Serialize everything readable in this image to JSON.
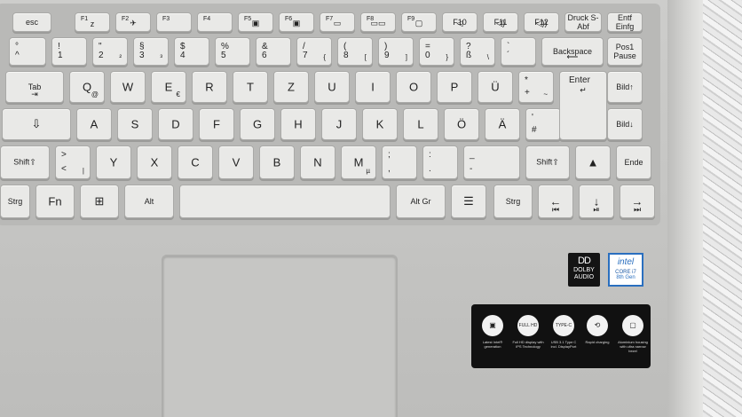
{
  "fn_row": [
    {
      "label": "esc"
    },
    {
      "label": "F1",
      "icon": "z"
    },
    {
      "label": "F2",
      "icon": "✈"
    },
    {
      "label": "F3"
    },
    {
      "label": "F4"
    },
    {
      "label": "F5",
      "icon": "▣"
    },
    {
      "label": "F6",
      "icon": "▣"
    },
    {
      "label": "F7",
      "icon": "▭"
    },
    {
      "label": "F8",
      "icon": "▭▭"
    },
    {
      "label": "F9",
      "icon": "▢"
    },
    {
      "label": "F10",
      "icon": "◁"
    },
    {
      "label": "F11",
      "icon": "◁)"
    },
    {
      "label": "F12",
      "icon": "◁))"
    },
    {
      "label": "Druck S-Abf"
    },
    {
      "label": "Entf Einfg"
    }
  ],
  "number_row": [
    {
      "top": "°",
      "bot": "^"
    },
    {
      "top": "!",
      "bot": "1"
    },
    {
      "top": "\"",
      "bot": "2",
      "sub": "²"
    },
    {
      "top": "§",
      "bot": "3",
      "sub": "³"
    },
    {
      "top": "$",
      "bot": "4"
    },
    {
      "top": "%",
      "bot": "5"
    },
    {
      "top": "&",
      "bot": "6"
    },
    {
      "top": "/",
      "bot": "7",
      "sub": "{"
    },
    {
      "top": "(",
      "bot": "8",
      "sub": "["
    },
    {
      "top": ")",
      "bot": "9",
      "sub": "]"
    },
    {
      "top": "=",
      "bot": "0",
      "sub": "}"
    },
    {
      "top": "?",
      "bot": "ß",
      "sub": "\\"
    },
    {
      "top": "`",
      "bot": "´"
    },
    {
      "label": "Backspace",
      "icon": "⟵"
    },
    {
      "label": "Pos1 Pause"
    }
  ],
  "qwertz_row": [
    {
      "label": "Tab",
      "icon": "⇥"
    },
    {
      "label": "Q",
      "sub": "@"
    },
    {
      "label": "W"
    },
    {
      "label": "E",
      "sub": "€"
    },
    {
      "label": "R"
    },
    {
      "label": "T"
    },
    {
      "label": "Z"
    },
    {
      "label": "U"
    },
    {
      "label": "I"
    },
    {
      "label": "O"
    },
    {
      "label": "P"
    },
    {
      "label": "Ü"
    },
    {
      "top": "*",
      "bot": "+",
      "sub": "~"
    },
    {
      "label": "Enter",
      "icon": "↵"
    },
    {
      "label": "Bild↑"
    }
  ],
  "home_row": [
    {
      "label": "⇩"
    },
    {
      "label": "A"
    },
    {
      "label": "S"
    },
    {
      "label": "D"
    },
    {
      "label": "F"
    },
    {
      "label": "G"
    },
    {
      "label": "H"
    },
    {
      "label": "J"
    },
    {
      "label": "K"
    },
    {
      "label": "L"
    },
    {
      "label": "Ö"
    },
    {
      "label": "Ä"
    },
    {
      "top": "'",
      "bot": "#"
    },
    {
      "label": "Bild↓"
    }
  ],
  "shift_row": [
    {
      "label": "Shift⇧"
    },
    {
      "top": ">",
      "bot": "<",
      "sub": "|"
    },
    {
      "label": "Y"
    },
    {
      "label": "X"
    },
    {
      "label": "C"
    },
    {
      "label": "V"
    },
    {
      "label": "B"
    },
    {
      "label": "N"
    },
    {
      "label": "M",
      "sub": "µ"
    },
    {
      "top": ";",
      "bot": ","
    },
    {
      "top": ":",
      "bot": "."
    },
    {
      "top": "_",
      "bot": "-"
    },
    {
      "label": "Shift⇧"
    },
    {
      "label": "▲"
    },
    {
      "label": "Ende"
    }
  ],
  "bottom_row": [
    {
      "label": "Strg"
    },
    {
      "label": "Fn"
    },
    {
      "label": "⊞"
    },
    {
      "label": "Alt"
    },
    {
      "label": ""
    },
    {
      "label": "Alt Gr"
    },
    {
      "label": "☰"
    },
    {
      "label": "Strg"
    },
    {
      "label": "←",
      "icon": "⏮"
    },
    {
      "label": "↓",
      "icon": "⏯"
    },
    {
      "label": "→",
      "icon": "⏭"
    }
  ],
  "dolby": {
    "top": "DD",
    "line1": "DOLBY",
    "line2": "AUDIO"
  },
  "intel": {
    "brand": "intel",
    "line1": "CORE i7",
    "line2": "8th Gen"
  },
  "sticker": [
    {
      "icon": "▣",
      "text": "Latest Intel® generation"
    },
    {
      "icon": "FULL HD",
      "text": "Full HD display with IPS Technology"
    },
    {
      "icon": "TYPE-C",
      "text": "USB 3.1 Type C incl. DisplayPort"
    },
    {
      "icon": "⟲",
      "text": "Rapid charging"
    },
    {
      "icon": "▢",
      "text": "Aluminium housing with ultra narrow bezel"
    }
  ]
}
